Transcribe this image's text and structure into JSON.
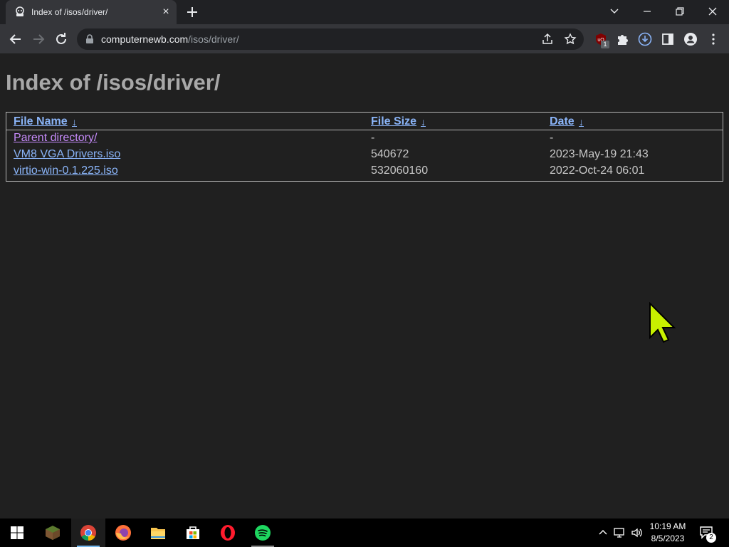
{
  "browser": {
    "tab_title": "Index of /isos/driver/",
    "tab_close": "×",
    "url_host": "computernewb.com",
    "url_path": "/isos/driver/",
    "extension_badge": "1"
  },
  "page": {
    "title": "Index of /isos/driver/",
    "columns": [
      {
        "label": "File Name",
        "sort_glyph": "↓"
      },
      {
        "label": "File Size",
        "sort_glyph": "↓"
      },
      {
        "label": "Date",
        "sort_glyph": "↓"
      }
    ],
    "rows": [
      {
        "name": "Parent directory/",
        "size": "-",
        "date": "-"
      },
      {
        "name": "VM8 VGA Drivers.iso",
        "size": "540672",
        "date": "2023-May-19 21:43"
      },
      {
        "name": "virtio-win-0.1.225.iso",
        "size": "532060160",
        "date": "2022-Oct-24 06:01"
      }
    ]
  },
  "taskbar": {
    "time": "10:19 AM",
    "date": "8/5/2023",
    "notification_count": "2"
  },
  "colors": {
    "link": "#8ab4f8",
    "visited_link": "#c58af9",
    "page_background": "#202020",
    "cursor": "#c8f000"
  }
}
